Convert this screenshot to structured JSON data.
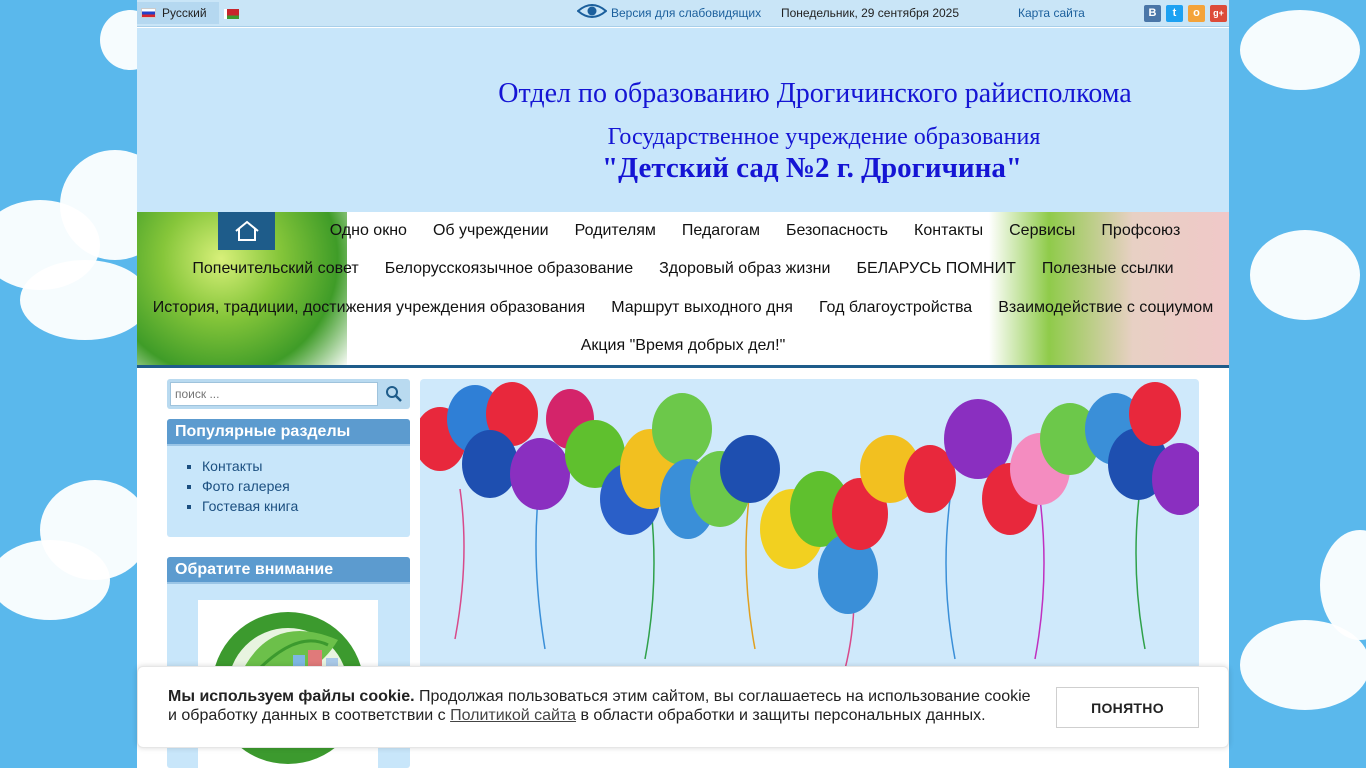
{
  "topbar": {
    "language": "Русский",
    "vision_link": "Версия для слабовидящих",
    "date": "Понедельник, 29 сентября 2025",
    "sitemap": "Карта сайта",
    "social": [
      "vk-icon",
      "twitter-icon",
      "odnoklassniki-icon",
      "google-plus-icon"
    ]
  },
  "header": {
    "title": "Отдел по образованию Дрогичинского райисполкома",
    "subtitle": "Государственное учреждение образования",
    "name": "\"Детский сад №2 г. Дрогичина\""
  },
  "nav": {
    "row1": [
      "Одно окно",
      "Об учреждении",
      "Родителям",
      "Педагогам",
      "Безопасность",
      "Контакты",
      "Сервисы",
      "Профсоюз"
    ],
    "row2": [
      "Попечительский совет",
      "Белорусскоязычное образование",
      "Здоровый образ жизни",
      "БЕЛАРУСЬ ПОМНИТ",
      "Полезные ссылки"
    ],
    "row3": [
      "История, традиции, достижения учреждения образования",
      "Маршрут выходного дня",
      "Год благоустройства",
      "Взаимодействие с социумом"
    ],
    "row4": [
      "Акция \"Время добрых дел!\""
    ]
  },
  "search": {
    "placeholder": "поиск ..."
  },
  "popular": {
    "title": "Популярные разделы",
    "items": [
      "Контакты",
      "Фото галерея",
      "Гостевая книга"
    ]
  },
  "attention": {
    "title": "Обратите внимание"
  },
  "cookie": {
    "bold": "Мы используем файлы cookie.",
    "text1": " Продолжая пользоваться этим сайтом, вы соглашаетесь на использование cookie и обработку данных в соответствии с ",
    "link": "Политикой сайта",
    "text2": " в области обработки и защиты персональных данных.",
    "button": "ПОНЯТНО"
  },
  "colors": {
    "accent": "#1e5c8a",
    "header_bg": "#c8e6fa",
    "title": "#1515d4",
    "module_head": "#5c9bcf"
  }
}
